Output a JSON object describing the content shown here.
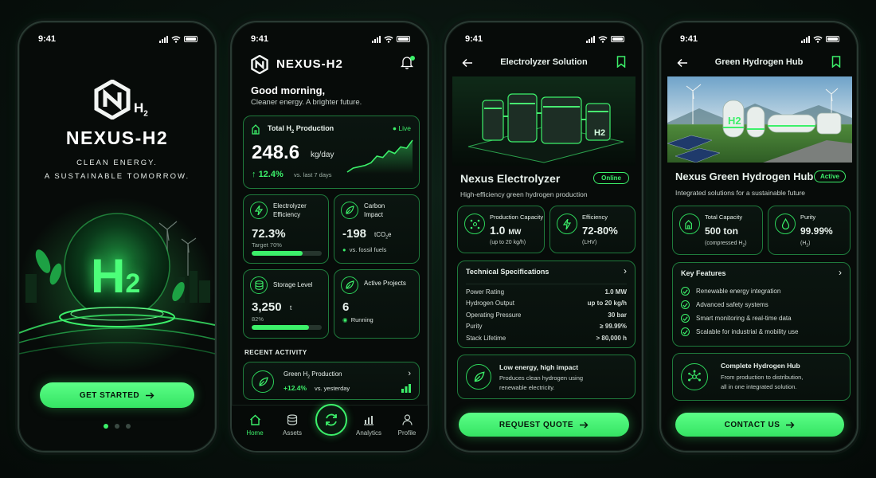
{
  "status_time": "9:41",
  "onboarding": {
    "brand": "NEXUS-H2",
    "logo_sub": "2",
    "tagline_1": "CLEAN ENERGY.",
    "tagline_2": "A SUSTAINABLE TOMORROW.",
    "hero_letter": "H",
    "hero_sub": "2",
    "cta": "GET STARTED",
    "page_dots": 3,
    "active_dot": 0
  },
  "dashboard": {
    "brand": "NEXUS-H2",
    "greeting": "Good morning,",
    "subgreeting": "Cleaner energy. A brighter future.",
    "production": {
      "title_pre": "Total H",
      "title_sub": "2",
      "title_post": " Production",
      "live": "Live",
      "value": "248.6",
      "unit": "kg/day",
      "change": "12.4%",
      "change_note": "vs. last 7 days",
      "trend": [
        2,
        5,
        6,
        7,
        9,
        14,
        13,
        18,
        16,
        21,
        20,
        26
      ]
    },
    "efficiency": {
      "title_1": "Electrolyzer",
      "title_2": "Efficiency",
      "value": "72.3%",
      "target": "Target 70%",
      "progress": 0.723
    },
    "carbon": {
      "title_1": "Carbon",
      "title_2": "Impact",
      "value": "-198",
      "unit": "tCO",
      "unit_sub": "2",
      "unit_post": "e",
      "note": "vs. fossil fuels"
    },
    "storage": {
      "title": "Storage Level",
      "value": "3,250",
      "unit": "t",
      "pct": "82%",
      "progress": 0.82
    },
    "projects": {
      "title": "Active Projects",
      "value": "6",
      "status": "Running"
    },
    "recent_label": "RECENT ACTIVITY",
    "activity": {
      "title_pre": "Green H",
      "title_sub": "2",
      "title_post": " Production",
      "change": "+12.4%",
      "note": "vs. yesterday"
    },
    "nav": [
      "Home",
      "Assets",
      "",
      "Analytics",
      "Profile"
    ]
  },
  "electrolyzer": {
    "header": "Electrolyzer Solution",
    "name": "Nexus Electrolyzer",
    "badge": "Online",
    "desc": "High-efficiency green hydrogen production",
    "capacity": {
      "label": "Production Capacity",
      "value": "1.0",
      "unit": "MW",
      "note": "(up to 20 kg/h)"
    },
    "eff": {
      "label": "Efficiency",
      "value": "72-80%",
      "note": "(LHV)"
    },
    "specs_title": "Technical Specifications",
    "specs": [
      {
        "k": "Power Rating",
        "v": "1.0 MW"
      },
      {
        "k": "Hydrogen Output",
        "v": "up to 20 kg/h"
      },
      {
        "k": "Operating Pressure",
        "v": "30 bar"
      },
      {
        "k": "Purity",
        "v": "≥ 99.99%"
      },
      {
        "k": "Stack Lifetime",
        "v": "> 80,000 h"
      }
    ],
    "impact_title": "Low energy, high impact",
    "impact_1": "Produces clean hydrogen using",
    "impact_2": "renewable electricity.",
    "cta": "REQUEST QUOTE",
    "image_label": "H2"
  },
  "hub": {
    "header": "Green Hydrogen Hub",
    "name": "Nexus Green Hydrogen Hub",
    "badge": "Active",
    "desc": "Integrated solutions for a sustainable future",
    "capacity": {
      "label": "Total Capacity",
      "value": "500 ton",
      "note_pre": "(compressed H",
      "note_sub": "2",
      "note_post": ")"
    },
    "purity": {
      "label": "Purity",
      "value": "99.99%",
      "note_pre": "(H",
      "note_sub": "2",
      "note_post": ")"
    },
    "features_title": "Key Features",
    "features": [
      "Renewable energy integration",
      "Advanced safety systems",
      "Smart monitoring & real-time data",
      "Scalable for industrial & mobility use"
    ],
    "complete_title": "Complete Hydrogen Hub",
    "complete_1": "From production to distribution,",
    "complete_2": "all in one integrated solution.",
    "cta": "CONTACT US",
    "image_label": "H2"
  },
  "colors": {
    "accent": "#3cf06a",
    "border": "#1f7a3c",
    "bg": "#070b09"
  }
}
